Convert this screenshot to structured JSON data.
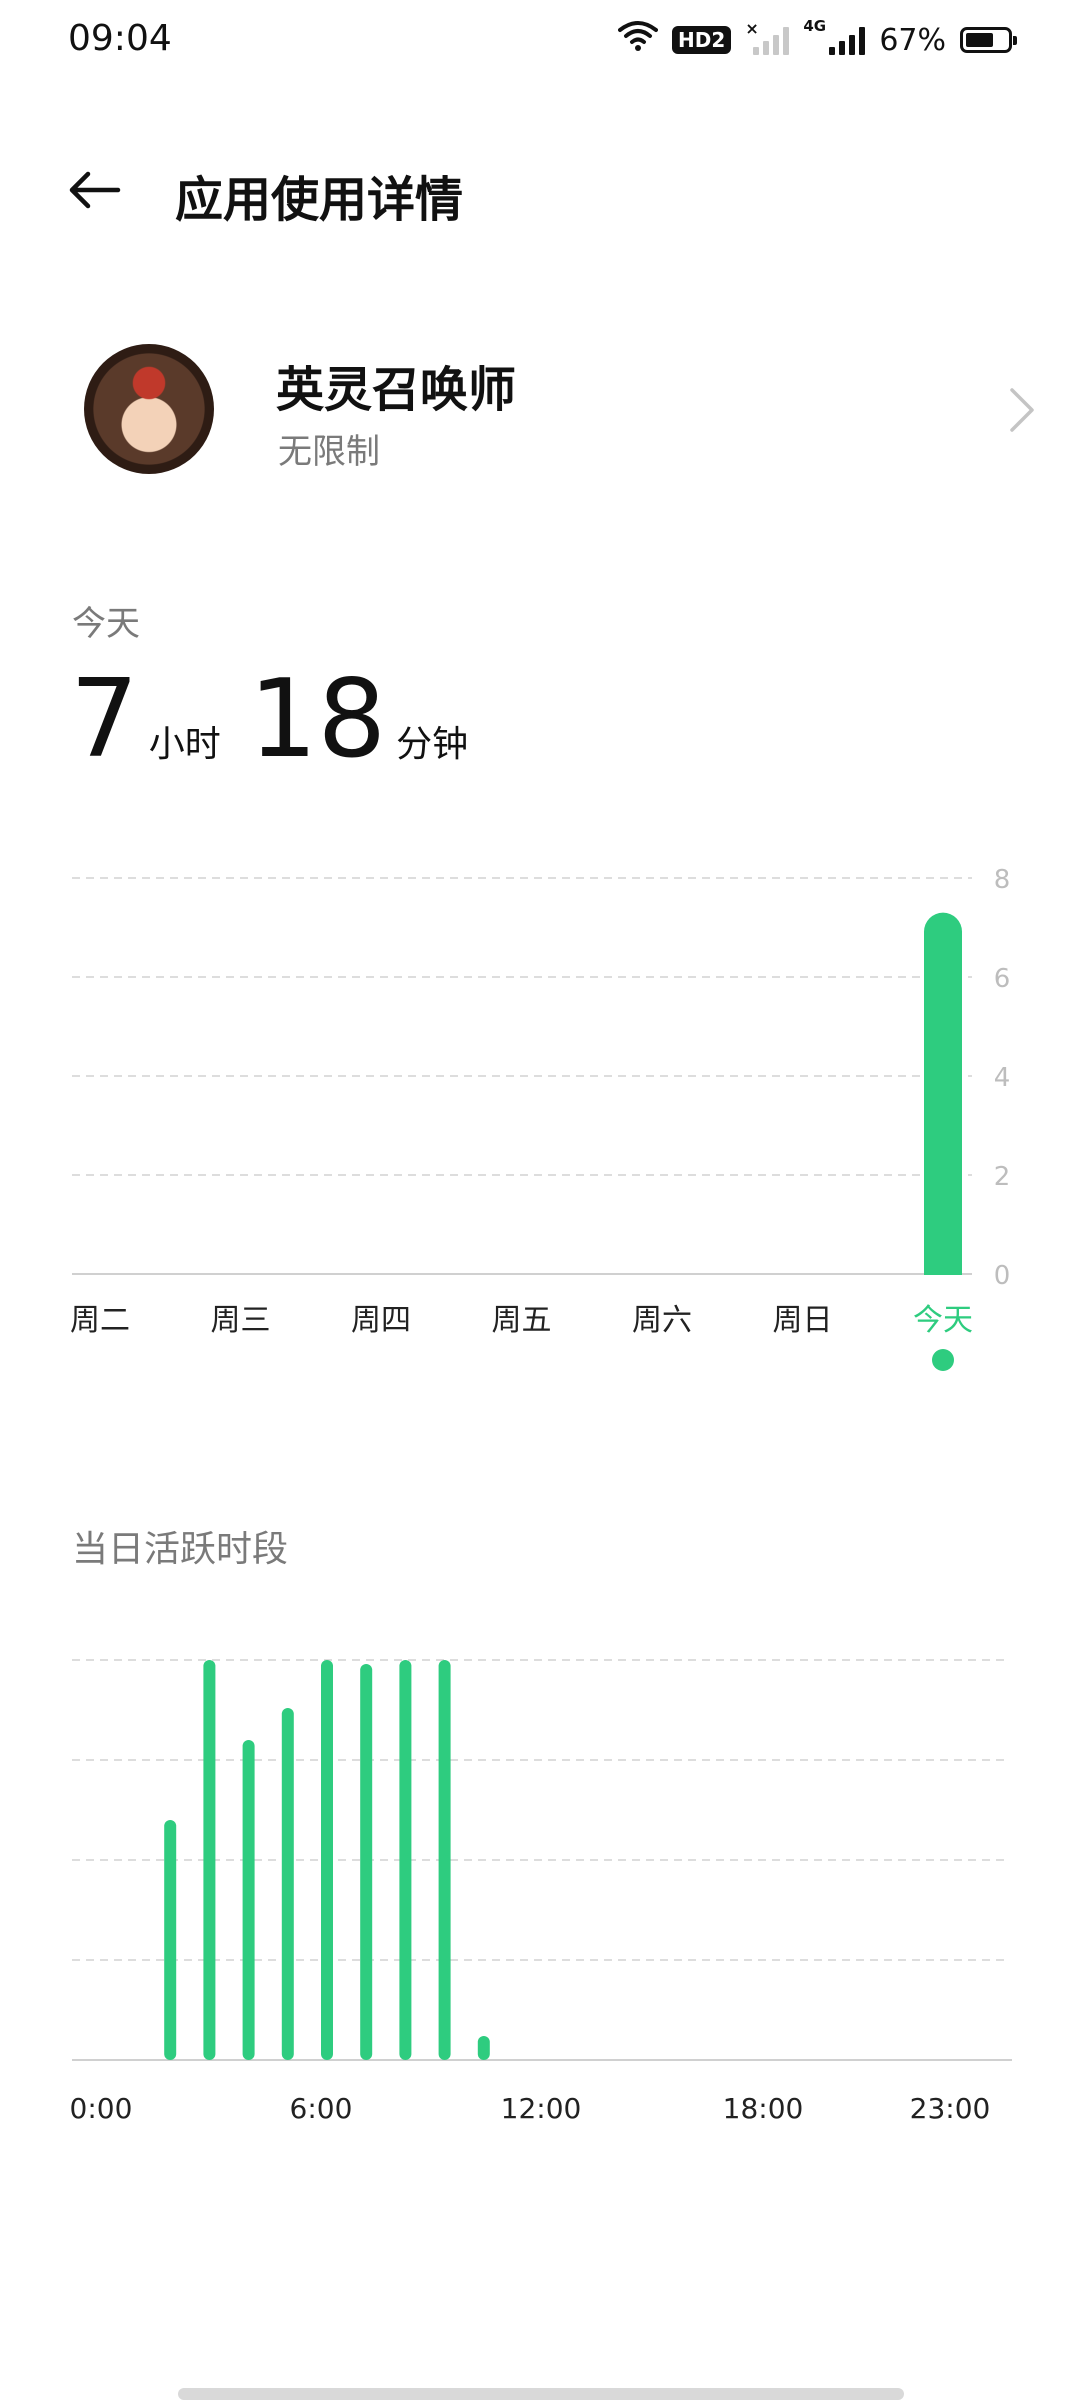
{
  "status_bar": {
    "time": "09:04",
    "hd_badge": "HD2",
    "network_type": "4G",
    "battery_text": "67%",
    "battery_level": 0.67
  },
  "header": {
    "back_icon": "arrow-left-icon",
    "title": "应用使用详情"
  },
  "app": {
    "name": "英灵召唤师",
    "status": "无限制",
    "avatar_icon": "app-avatar-image",
    "chevron_icon": "chevron-right-icon"
  },
  "today": {
    "label": "今天",
    "hours": "7",
    "hours_unit": "小时",
    "minutes": "18",
    "minutes_unit": "分钟"
  },
  "activity": {
    "label": "当日活跃时段"
  },
  "colors": {
    "accent": "#2ecc7f",
    "muted_text": "#7a7a7a",
    "grid": "#dddddd",
    "axis_text": "#bdbdbd"
  },
  "chart_data": [
    {
      "type": "bar",
      "categories": [
        "周二",
        "周三",
        "周四",
        "周五",
        "周六",
        "周日",
        "今天"
      ],
      "values": [
        0,
        0,
        0,
        0,
        0,
        0,
        7.3
      ],
      "selected_index": 6,
      "ylim": [
        0,
        8
      ],
      "yticks": [
        "0",
        "2",
        "4",
        "6",
        "8"
      ],
      "grid": true,
      "y_axis_position": "right"
    },
    {
      "type": "bar",
      "x": [
        0,
        1,
        2,
        3,
        4,
        5,
        6,
        7,
        8,
        9,
        10,
        11,
        12,
        13,
        14,
        15,
        16,
        17,
        18,
        19,
        20,
        21,
        22,
        23
      ],
      "values": [
        0,
        0.6,
        1.0,
        0.8,
        0.88,
        1.0,
        0.99,
        1.0,
        1.0,
        0.06,
        0,
        0,
        0,
        0,
        0,
        0,
        0,
        0,
        0,
        0,
        0,
        0,
        0,
        0
      ],
      "ylim": [
        0,
        1
      ],
      "xticks": [
        "0:00",
        "6:00",
        "12:00",
        "18:00",
        "23:00"
      ],
      "grid": true
    }
  ]
}
